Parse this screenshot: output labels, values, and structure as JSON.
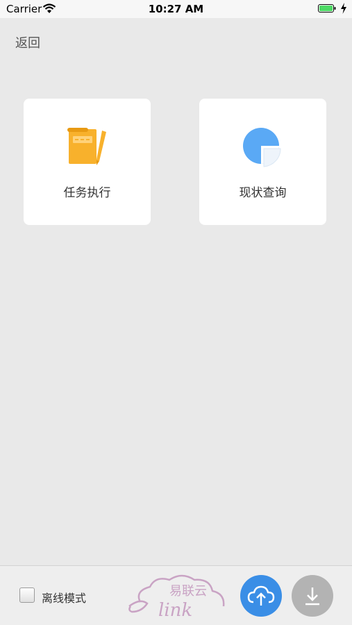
{
  "status_bar": {
    "carrier": "Carrier",
    "time": "10:27 AM",
    "wifi_icon": "wifi-icon",
    "battery_icon": "battery-icon",
    "charging_icon": "charging-bolt-icon"
  },
  "nav": {
    "back_label": "返回"
  },
  "tiles": [
    {
      "label": "任务执行",
      "icon": "notebook-pencil-icon",
      "icon_color": "#f8b12c"
    },
    {
      "label": "现状查询",
      "icon": "pie-chart-icon",
      "icon_color": "#5aa9f5"
    }
  ],
  "bottom_bar": {
    "offline_mode_label": "离线模式",
    "offline_mode_checked": false,
    "logo_text": "易联云",
    "logo_subtext": "link",
    "upload_icon": "cloud-upload-icon",
    "upload_color": "#3a8ee6",
    "download_icon": "download-icon",
    "download_color": "#b3b3b3"
  },
  "colors": {
    "background": "#e9e9e9",
    "card": "#ffffff",
    "logo": "#c9a3c4"
  }
}
